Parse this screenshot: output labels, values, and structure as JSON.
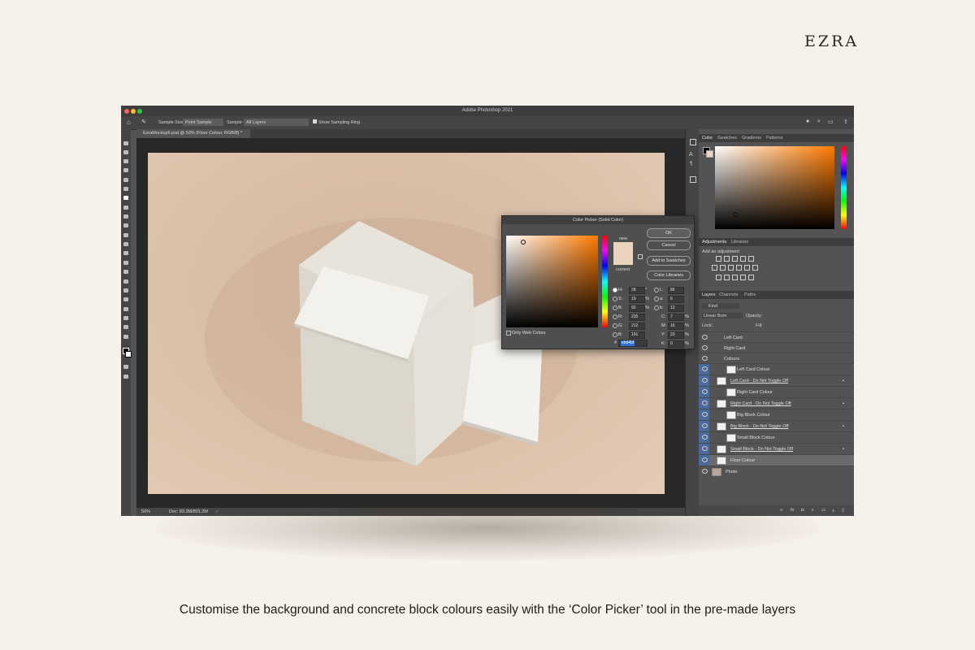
{
  "brand": "EZRA",
  "caption": "Customise the background and concrete block colours easily with the ‘Color Picker’ tool in the pre-made layers",
  "app": {
    "title": "Adobe Photoshop 2021",
    "options": {
      "sample_size_label": "Sample Size:",
      "sample_size_value": "Point Sample",
      "sample_label": "Sample:",
      "sample_value": "All Layers",
      "show_ring_label": "Show Sampling Ring"
    },
    "document_tab": "EzraMockup5.psd @ 50% (Floor Colour, RGB/8) *",
    "status": {
      "zoom": "50%",
      "doc": "Doc: 83.3M/801.2M"
    },
    "color_panel": {
      "tabs": [
        "Color",
        "Swatches",
        "Gradients",
        "Patterns"
      ]
    },
    "adjustments_panel": {
      "tabs": [
        "Adjustments",
        "Libraries"
      ],
      "hint": "Add an adjustment"
    },
    "layers_panel": {
      "tabs": [
        "Layers",
        "Channels",
        "Paths"
      ],
      "kind_placeholder": "Kind",
      "blend_mode": "Linear Burn",
      "opacity_label": "Opacity:",
      "lock_label": "Lock:",
      "fill_label": "Fill:",
      "layers": [
        {
          "name": "Left Card"
        },
        {
          "name": "Right Card"
        },
        {
          "name": "Colours"
        },
        {
          "name": "Left Card Colour"
        },
        {
          "name": "Left Card - Do Not Toggle Off"
        },
        {
          "name": "Right Card Colour"
        },
        {
          "name": "Right Card - Do Not Toggle Off"
        },
        {
          "name": "Big Block Colour"
        },
        {
          "name": "Big Block - Do Not Toggle Off"
        },
        {
          "name": "Small Block Colour"
        },
        {
          "name": "Small Block - Do Not Toggle Off"
        },
        {
          "name": "Floor Colour"
        },
        {
          "name": "Photo"
        }
      ]
    },
    "color_picker": {
      "title": "Color Picker (Solid Color)",
      "ok": "OK",
      "cancel": "Cancel",
      "add_swatches": "Add to Swatches",
      "color_libraries": "Color Libraries",
      "new_label": "new",
      "current_label": "current",
      "only_web": "Only Web Colors",
      "hex_label": "#",
      "hex": "ebd4bf",
      "new_color": "#ebd4bf",
      "current_color": "#ebd4bf",
      "fields": {
        "H": "28",
        "H_unit": "°",
        "S": "19",
        "S_unit": "%",
        "B": "92",
        "B_unit": "%",
        "R": "235",
        "G": "212",
        "B2": "191",
        "L": "86",
        "a": "6",
        "b": "13",
        "C": "7",
        "M": "16",
        "Y": "23",
        "K": "0",
        "pct": "%"
      }
    }
  }
}
